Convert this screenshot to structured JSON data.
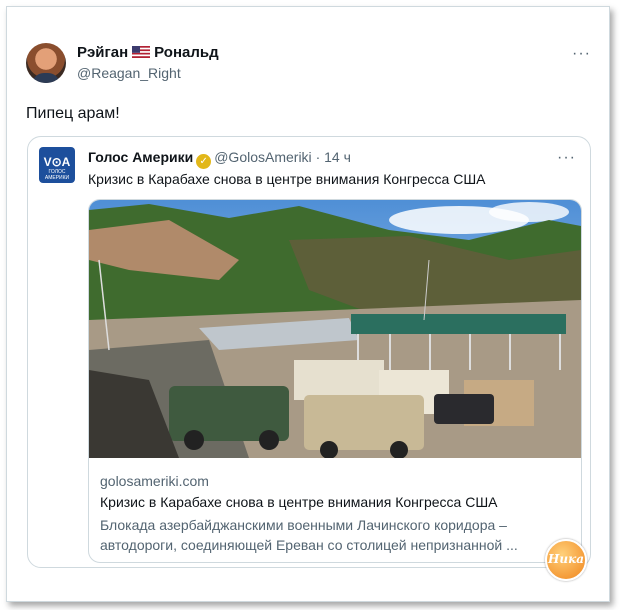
{
  "tweet": {
    "author_name_first": "Рэйган",
    "author_name_last": "Рональд",
    "handle": "@Reagan_Right",
    "more": "···",
    "text": "Пипец арам!"
  },
  "quoted": {
    "logo_text": "V⊙A",
    "logo_subtext": "ГОЛОС АМЕРИКИ",
    "author": "Голос Америки",
    "handle": "@GolosAmeriki",
    "separator": "·",
    "time": "14 ч",
    "more": "···",
    "text": "Кризис в Карабахе снова в центре внимания Конгресса США",
    "card": {
      "domain": "golosameriki.com",
      "title": "Кризис в Карабахе снова в центре внимания Конгресса США",
      "description": "Блокада азербайджанскими военными Лачинского коридора – автодороги, соединяющей Ереван со столицей непризнанной ..."
    }
  },
  "watermark": {
    "text": "Ника"
  },
  "colors": {
    "accent": "#1d9bf0",
    "verified": "#e2b719",
    "muted": "#536471",
    "border": "#cfd9de"
  }
}
